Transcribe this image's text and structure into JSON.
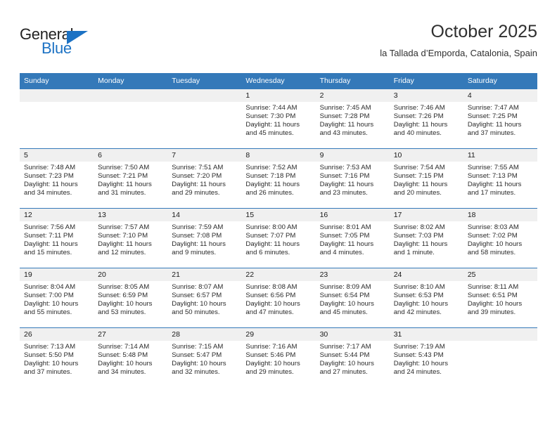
{
  "brand": {
    "name_top": "General",
    "name_bottom": "Blue",
    "accent_color": "#1c72c4"
  },
  "header": {
    "title": "October 2025",
    "subtitle": "la Tallada d’Emporda, Catalonia, Spain"
  },
  "calendar": {
    "header_bg": "#3479b9",
    "daynum_bg": "#f0f0f0",
    "weekday_headers": [
      "Sunday",
      "Monday",
      "Tuesday",
      "Wednesday",
      "Thursday",
      "Friday",
      "Saturday"
    ],
    "weeks": [
      [
        {
          "day": "",
          "lines": []
        },
        {
          "day": "",
          "lines": []
        },
        {
          "day": "",
          "lines": []
        },
        {
          "day": "1",
          "lines": [
            "Sunrise: 7:44 AM",
            "Sunset: 7:30 PM",
            "Daylight: 11 hours and 45 minutes."
          ]
        },
        {
          "day": "2",
          "lines": [
            "Sunrise: 7:45 AM",
            "Sunset: 7:28 PM",
            "Daylight: 11 hours and 43 minutes."
          ]
        },
        {
          "day": "3",
          "lines": [
            "Sunrise: 7:46 AM",
            "Sunset: 7:26 PM",
            "Daylight: 11 hours and 40 minutes."
          ]
        },
        {
          "day": "4",
          "lines": [
            "Sunrise: 7:47 AM",
            "Sunset: 7:25 PM",
            "Daylight: 11 hours and 37 minutes."
          ]
        }
      ],
      [
        {
          "day": "5",
          "lines": [
            "Sunrise: 7:48 AM",
            "Sunset: 7:23 PM",
            "Daylight: 11 hours and 34 minutes."
          ]
        },
        {
          "day": "6",
          "lines": [
            "Sunrise: 7:50 AM",
            "Sunset: 7:21 PM",
            "Daylight: 11 hours and 31 minutes."
          ]
        },
        {
          "day": "7",
          "lines": [
            "Sunrise: 7:51 AM",
            "Sunset: 7:20 PM",
            "Daylight: 11 hours and 29 minutes."
          ]
        },
        {
          "day": "8",
          "lines": [
            "Sunrise: 7:52 AM",
            "Sunset: 7:18 PM",
            "Daylight: 11 hours and 26 minutes."
          ]
        },
        {
          "day": "9",
          "lines": [
            "Sunrise: 7:53 AM",
            "Sunset: 7:16 PM",
            "Daylight: 11 hours and 23 minutes."
          ]
        },
        {
          "day": "10",
          "lines": [
            "Sunrise: 7:54 AM",
            "Sunset: 7:15 PM",
            "Daylight: 11 hours and 20 minutes."
          ]
        },
        {
          "day": "11",
          "lines": [
            "Sunrise: 7:55 AM",
            "Sunset: 7:13 PM",
            "Daylight: 11 hours and 17 minutes."
          ]
        }
      ],
      [
        {
          "day": "12",
          "lines": [
            "Sunrise: 7:56 AM",
            "Sunset: 7:11 PM",
            "Daylight: 11 hours and 15 minutes."
          ]
        },
        {
          "day": "13",
          "lines": [
            "Sunrise: 7:57 AM",
            "Sunset: 7:10 PM",
            "Daylight: 11 hours and 12 minutes."
          ]
        },
        {
          "day": "14",
          "lines": [
            "Sunrise: 7:59 AM",
            "Sunset: 7:08 PM",
            "Daylight: 11 hours and 9 minutes."
          ]
        },
        {
          "day": "15",
          "lines": [
            "Sunrise: 8:00 AM",
            "Sunset: 7:07 PM",
            "Daylight: 11 hours and 6 minutes."
          ]
        },
        {
          "day": "16",
          "lines": [
            "Sunrise: 8:01 AM",
            "Sunset: 7:05 PM",
            "Daylight: 11 hours and 4 minutes."
          ]
        },
        {
          "day": "17",
          "lines": [
            "Sunrise: 8:02 AM",
            "Sunset: 7:03 PM",
            "Daylight: 11 hours and 1 minute."
          ]
        },
        {
          "day": "18",
          "lines": [
            "Sunrise: 8:03 AM",
            "Sunset: 7:02 PM",
            "Daylight: 10 hours and 58 minutes."
          ]
        }
      ],
      [
        {
          "day": "19",
          "lines": [
            "Sunrise: 8:04 AM",
            "Sunset: 7:00 PM",
            "Daylight: 10 hours and 55 minutes."
          ]
        },
        {
          "day": "20",
          "lines": [
            "Sunrise: 8:05 AM",
            "Sunset: 6:59 PM",
            "Daylight: 10 hours and 53 minutes."
          ]
        },
        {
          "day": "21",
          "lines": [
            "Sunrise: 8:07 AM",
            "Sunset: 6:57 PM",
            "Daylight: 10 hours and 50 minutes."
          ]
        },
        {
          "day": "22",
          "lines": [
            "Sunrise: 8:08 AM",
            "Sunset: 6:56 PM",
            "Daylight: 10 hours and 47 minutes."
          ]
        },
        {
          "day": "23",
          "lines": [
            "Sunrise: 8:09 AM",
            "Sunset: 6:54 PM",
            "Daylight: 10 hours and 45 minutes."
          ]
        },
        {
          "day": "24",
          "lines": [
            "Sunrise: 8:10 AM",
            "Sunset: 6:53 PM",
            "Daylight: 10 hours and 42 minutes."
          ]
        },
        {
          "day": "25",
          "lines": [
            "Sunrise: 8:11 AM",
            "Sunset: 6:51 PM",
            "Daylight: 10 hours and 39 minutes."
          ]
        }
      ],
      [
        {
          "day": "26",
          "lines": [
            "Sunrise: 7:13 AM",
            "Sunset: 5:50 PM",
            "Daylight: 10 hours and 37 minutes."
          ]
        },
        {
          "day": "27",
          "lines": [
            "Sunrise: 7:14 AM",
            "Sunset: 5:48 PM",
            "Daylight: 10 hours and 34 minutes."
          ]
        },
        {
          "day": "28",
          "lines": [
            "Sunrise: 7:15 AM",
            "Sunset: 5:47 PM",
            "Daylight: 10 hours and 32 minutes."
          ]
        },
        {
          "day": "29",
          "lines": [
            "Sunrise: 7:16 AM",
            "Sunset: 5:46 PM",
            "Daylight: 10 hours and 29 minutes."
          ]
        },
        {
          "day": "30",
          "lines": [
            "Sunrise: 7:17 AM",
            "Sunset: 5:44 PM",
            "Daylight: 10 hours and 27 minutes."
          ]
        },
        {
          "day": "31",
          "lines": [
            "Sunrise: 7:19 AM",
            "Sunset: 5:43 PM",
            "Daylight: 10 hours and 24 minutes."
          ]
        },
        {
          "day": "",
          "lines": []
        }
      ]
    ]
  }
}
